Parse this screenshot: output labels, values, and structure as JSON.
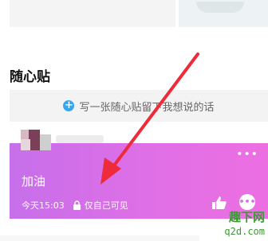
{
  "section": {
    "title": "随心贴"
  },
  "write_bar": {
    "icon": "plus-icon",
    "text": "写一张随心贴留下我想说的话"
  },
  "note": {
    "text": "加油",
    "time": "今天15:03",
    "visibility": "仅自己可见",
    "more_label": "•••",
    "comment_label": "•••",
    "gradient_colors": [
      "#c66fea",
      "#ec6fe2"
    ]
  },
  "annotation": {
    "arrow_color": "#ee2b3a"
  },
  "watermark": {
    "line1": "趣下网",
    "line2": "q2d.com"
  },
  "colors": {
    "accent": "#35a7f0"
  }
}
